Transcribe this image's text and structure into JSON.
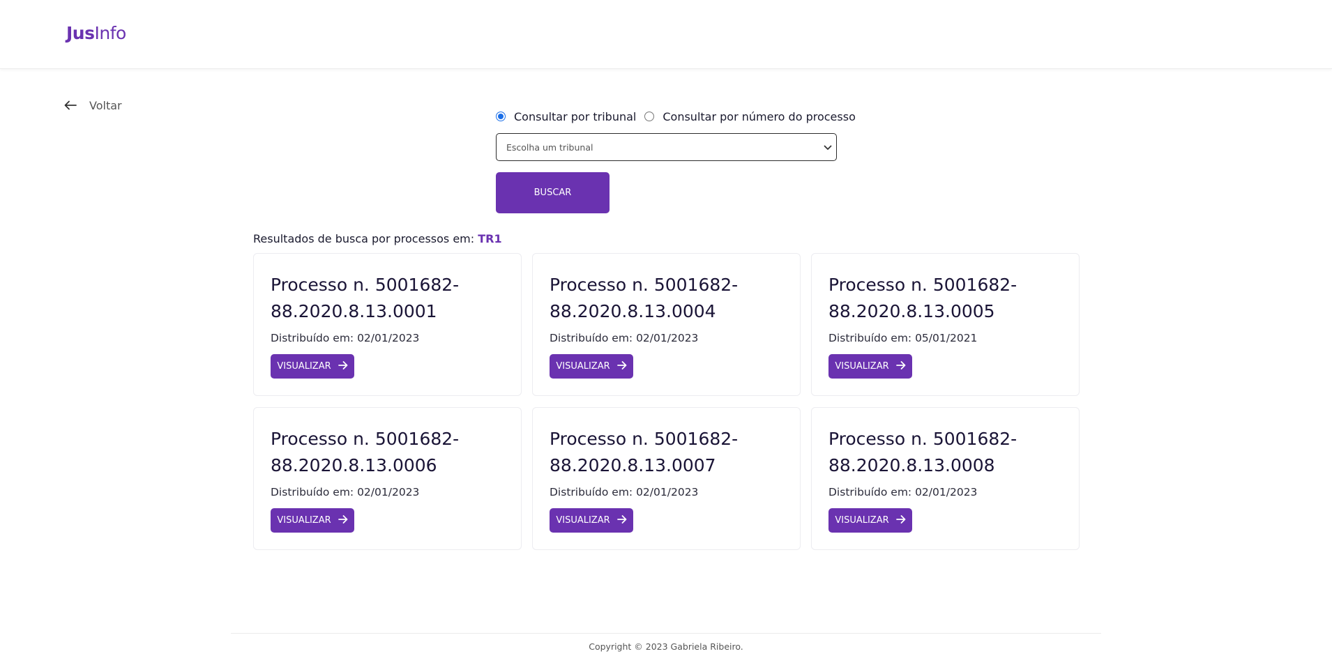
{
  "header": {
    "logo_bold": "Jus",
    "logo_rest": "Info"
  },
  "back": {
    "label": "Voltar",
    "icon": "arrow-left-icon"
  },
  "search": {
    "options": [
      {
        "label": "Consultar por tribunal",
        "checked": true
      },
      {
        "label": "Consultar por número do processo",
        "checked": false
      }
    ],
    "select_value": "Escolha um tribunal",
    "button_label": "BUSCAR"
  },
  "results": {
    "prefix": "Resultados de busca por processos em: ",
    "court": "TR1",
    "cards": [
      {
        "title": "Processo n. 5001682-88.2020.8.13.0001",
        "title_line1": "Processo n. 5001682-",
        "title_line2": "88.2020.8.13.0001",
        "date": "Distribuído em: 02/01/2023",
        "button": "VISUALIZAR"
      },
      {
        "title": "Processo n. 5001682-88.2020.8.13.0004",
        "title_line1": "Processo n. 5001682-",
        "title_line2": "88.2020.8.13.0004",
        "date": "Distribuído em: 02/01/2023",
        "button": "VISUALIZAR"
      },
      {
        "title": "Processo n. 5001682-88.2020.8.13.0005",
        "title_line1": "Processo n. 5001682-",
        "title_line2": "88.2020.8.13.0005",
        "date": "Distribuído em: 05/01/2021",
        "button": "VISUALIZAR"
      },
      {
        "title": "Processo n. 5001682-88.2020.8.13.0006",
        "title_line1": "Processo n. 5001682-",
        "title_line2": "88.2020.8.13.0006",
        "date": "Distribuído em: 02/01/2023",
        "button": "VISUALIZAR"
      },
      {
        "title": "Processo n. 5001682-88.2020.8.13.0007",
        "title_line1": "Processo n. 5001682-",
        "title_line2": "88.2020.8.13.0007",
        "date": "Distribuído em: 02/01/2023",
        "button": "VISUALIZAR"
      },
      {
        "title": "Processo n. 5001682-88.2020.8.13.0008",
        "title_line1": "Processo n. 5001682-",
        "title_line2": "88.2020.8.13.0008",
        "date": "Distribuído em: 02/01/2023",
        "button": "VISUALIZAR"
      }
    ]
  },
  "footer": {
    "text": "Copyright © 2023 Gabriela Ribeiro."
  },
  "colors": {
    "brand": "#6a32b0",
    "radio_active": "#1a6ee8"
  }
}
